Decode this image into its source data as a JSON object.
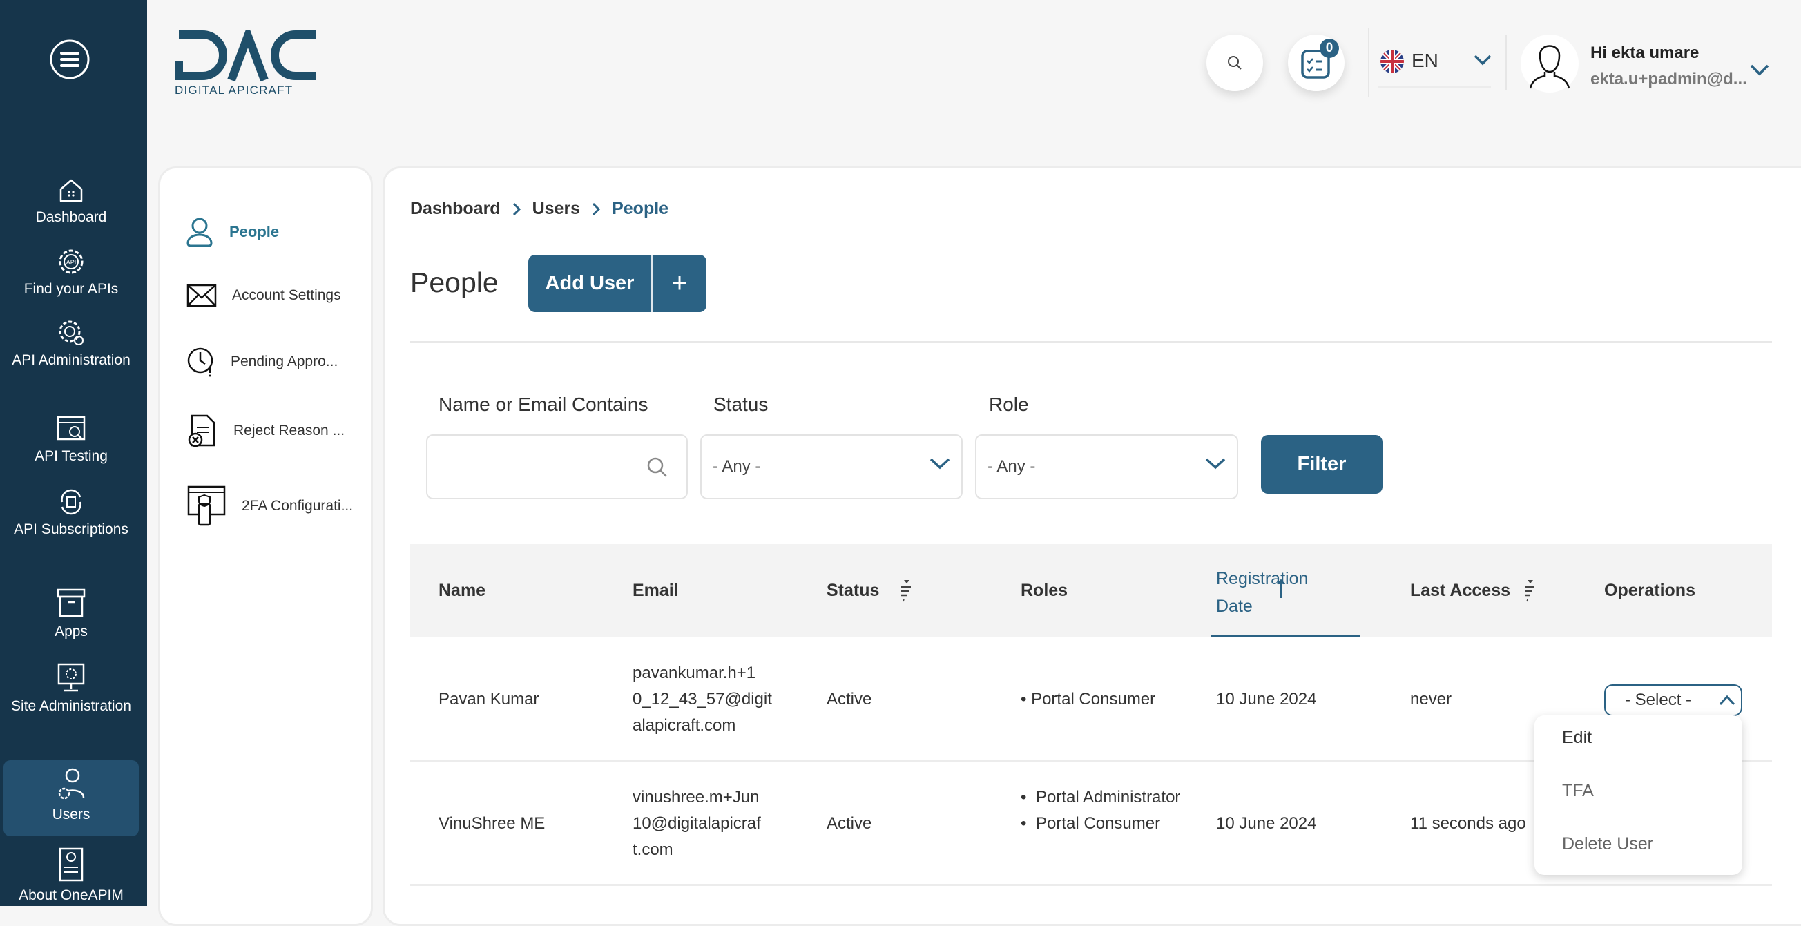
{
  "colors": {
    "sidebar": "#16354b",
    "accent": "#2b6284",
    "active_nav": "#24506f"
  },
  "logo": {
    "text": "DAC",
    "subtitle": "DIGITAL APICRAFT"
  },
  "sidebar": {
    "items": [
      {
        "label": "Dashboard",
        "icon": "home-icon"
      },
      {
        "label": "Find your APIs",
        "icon": "api-gear-icon"
      },
      {
        "label": "API Administration",
        "icon": "api-admin-icon"
      },
      {
        "label": "API Testing",
        "icon": "api-testing-icon"
      },
      {
        "label": "API Subscriptions",
        "icon": "api-subscriptions-icon"
      },
      {
        "label": "Apps",
        "icon": "apps-box-icon"
      },
      {
        "label": "Site Administration",
        "icon": "site-admin-icon"
      },
      {
        "label": "Users",
        "icon": "users-icon",
        "active": true
      },
      {
        "label": "About OneAPIM",
        "icon": "about-icon"
      }
    ]
  },
  "header": {
    "tasks_badge": "0",
    "language": "EN",
    "greeting": "Hi ekta umare",
    "email": "ekta.u+padmin@d..."
  },
  "subnav": {
    "items": [
      {
        "label": "People",
        "active": true
      },
      {
        "label": "Account Settings"
      },
      {
        "label": "Pending Appro..."
      },
      {
        "label": "Reject Reason ..."
      },
      {
        "label": "2FA Configurati..."
      }
    ]
  },
  "breadcrumb": [
    "Dashboard",
    "Users",
    "People"
  ],
  "page": {
    "title": "People",
    "add_user": "Add User",
    "add_icon": "+"
  },
  "filters": {
    "name_label": "Name or Email Contains",
    "name_value": "",
    "status_label": "Status",
    "status_value": "- Any -",
    "role_label": "Role",
    "role_value": "- Any -",
    "filter_button": "Filter"
  },
  "table": {
    "headers": [
      "Name",
      "Email",
      "Status",
      "Roles",
      "Registration Date",
      "Last Access",
      "Operations"
    ],
    "sorted_column": "Registration Date",
    "rows": [
      {
        "name": "Pavan Kumar",
        "email_lines": [
          "pavankumar.h+1",
          "0_12_43_57@digit",
          "alapicraft.com"
        ],
        "status": "Active",
        "roles": [
          "Portal Consumer"
        ],
        "registered": "10 June 2024",
        "last_access": "never",
        "operation": "- Select -"
      },
      {
        "name": "VinuShree ME",
        "email_lines": [
          "vinushree.m+Jun",
          "10@digitalapicraf",
          "t.com"
        ],
        "status": "Active",
        "roles": [
          "Portal Administrator",
          "Portal Consumer"
        ],
        "registered": "10 June 2024",
        "last_access": "11 seconds ago"
      }
    ]
  },
  "operations_menu": [
    "Edit",
    "TFA",
    "Delete User"
  ]
}
